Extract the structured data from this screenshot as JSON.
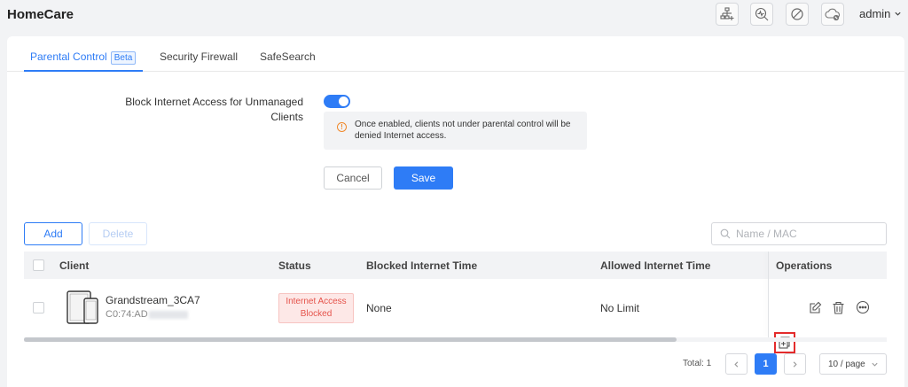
{
  "app": {
    "title": "HomeCare"
  },
  "topbar": {
    "icons": [
      "network-topology-icon",
      "diagnostics-icon",
      "block-icon",
      "cloud-icon"
    ],
    "user": "admin"
  },
  "tabs": [
    {
      "label": "Parental Control",
      "badge": "Beta",
      "active": true
    },
    {
      "label": "Security Firewall",
      "active": false
    },
    {
      "label": "SafeSearch",
      "active": false
    }
  ],
  "setting": {
    "label": "Block Internet Access for Unmanaged Clients",
    "enabled": true,
    "notice": "Once enabled, clients not under parental control will be denied Internet access."
  },
  "form_buttons": {
    "cancel": "Cancel",
    "save": "Save"
  },
  "toolbar": {
    "add": "Add",
    "delete": "Delete",
    "search_placeholder": "Name / MAC"
  },
  "table": {
    "columns": [
      "Client",
      "Status",
      "Blocked Internet Time",
      "Allowed Internet Time",
      "Operations"
    ],
    "rows": [
      {
        "name": "Grandstream_3CA7",
        "mac": "C0:74:AD",
        "status_line1": "Internet Access",
        "status_line2": "Blocked",
        "blocked_time": "None",
        "allowed_time": "No Limit"
      }
    ]
  },
  "pagination": {
    "total": "Total: 1",
    "current_page": "1",
    "page_size": "10 / page"
  },
  "colors": {
    "accent": "#2e7cf6",
    "danger": "#e5534b",
    "warning": "#f0892c"
  }
}
